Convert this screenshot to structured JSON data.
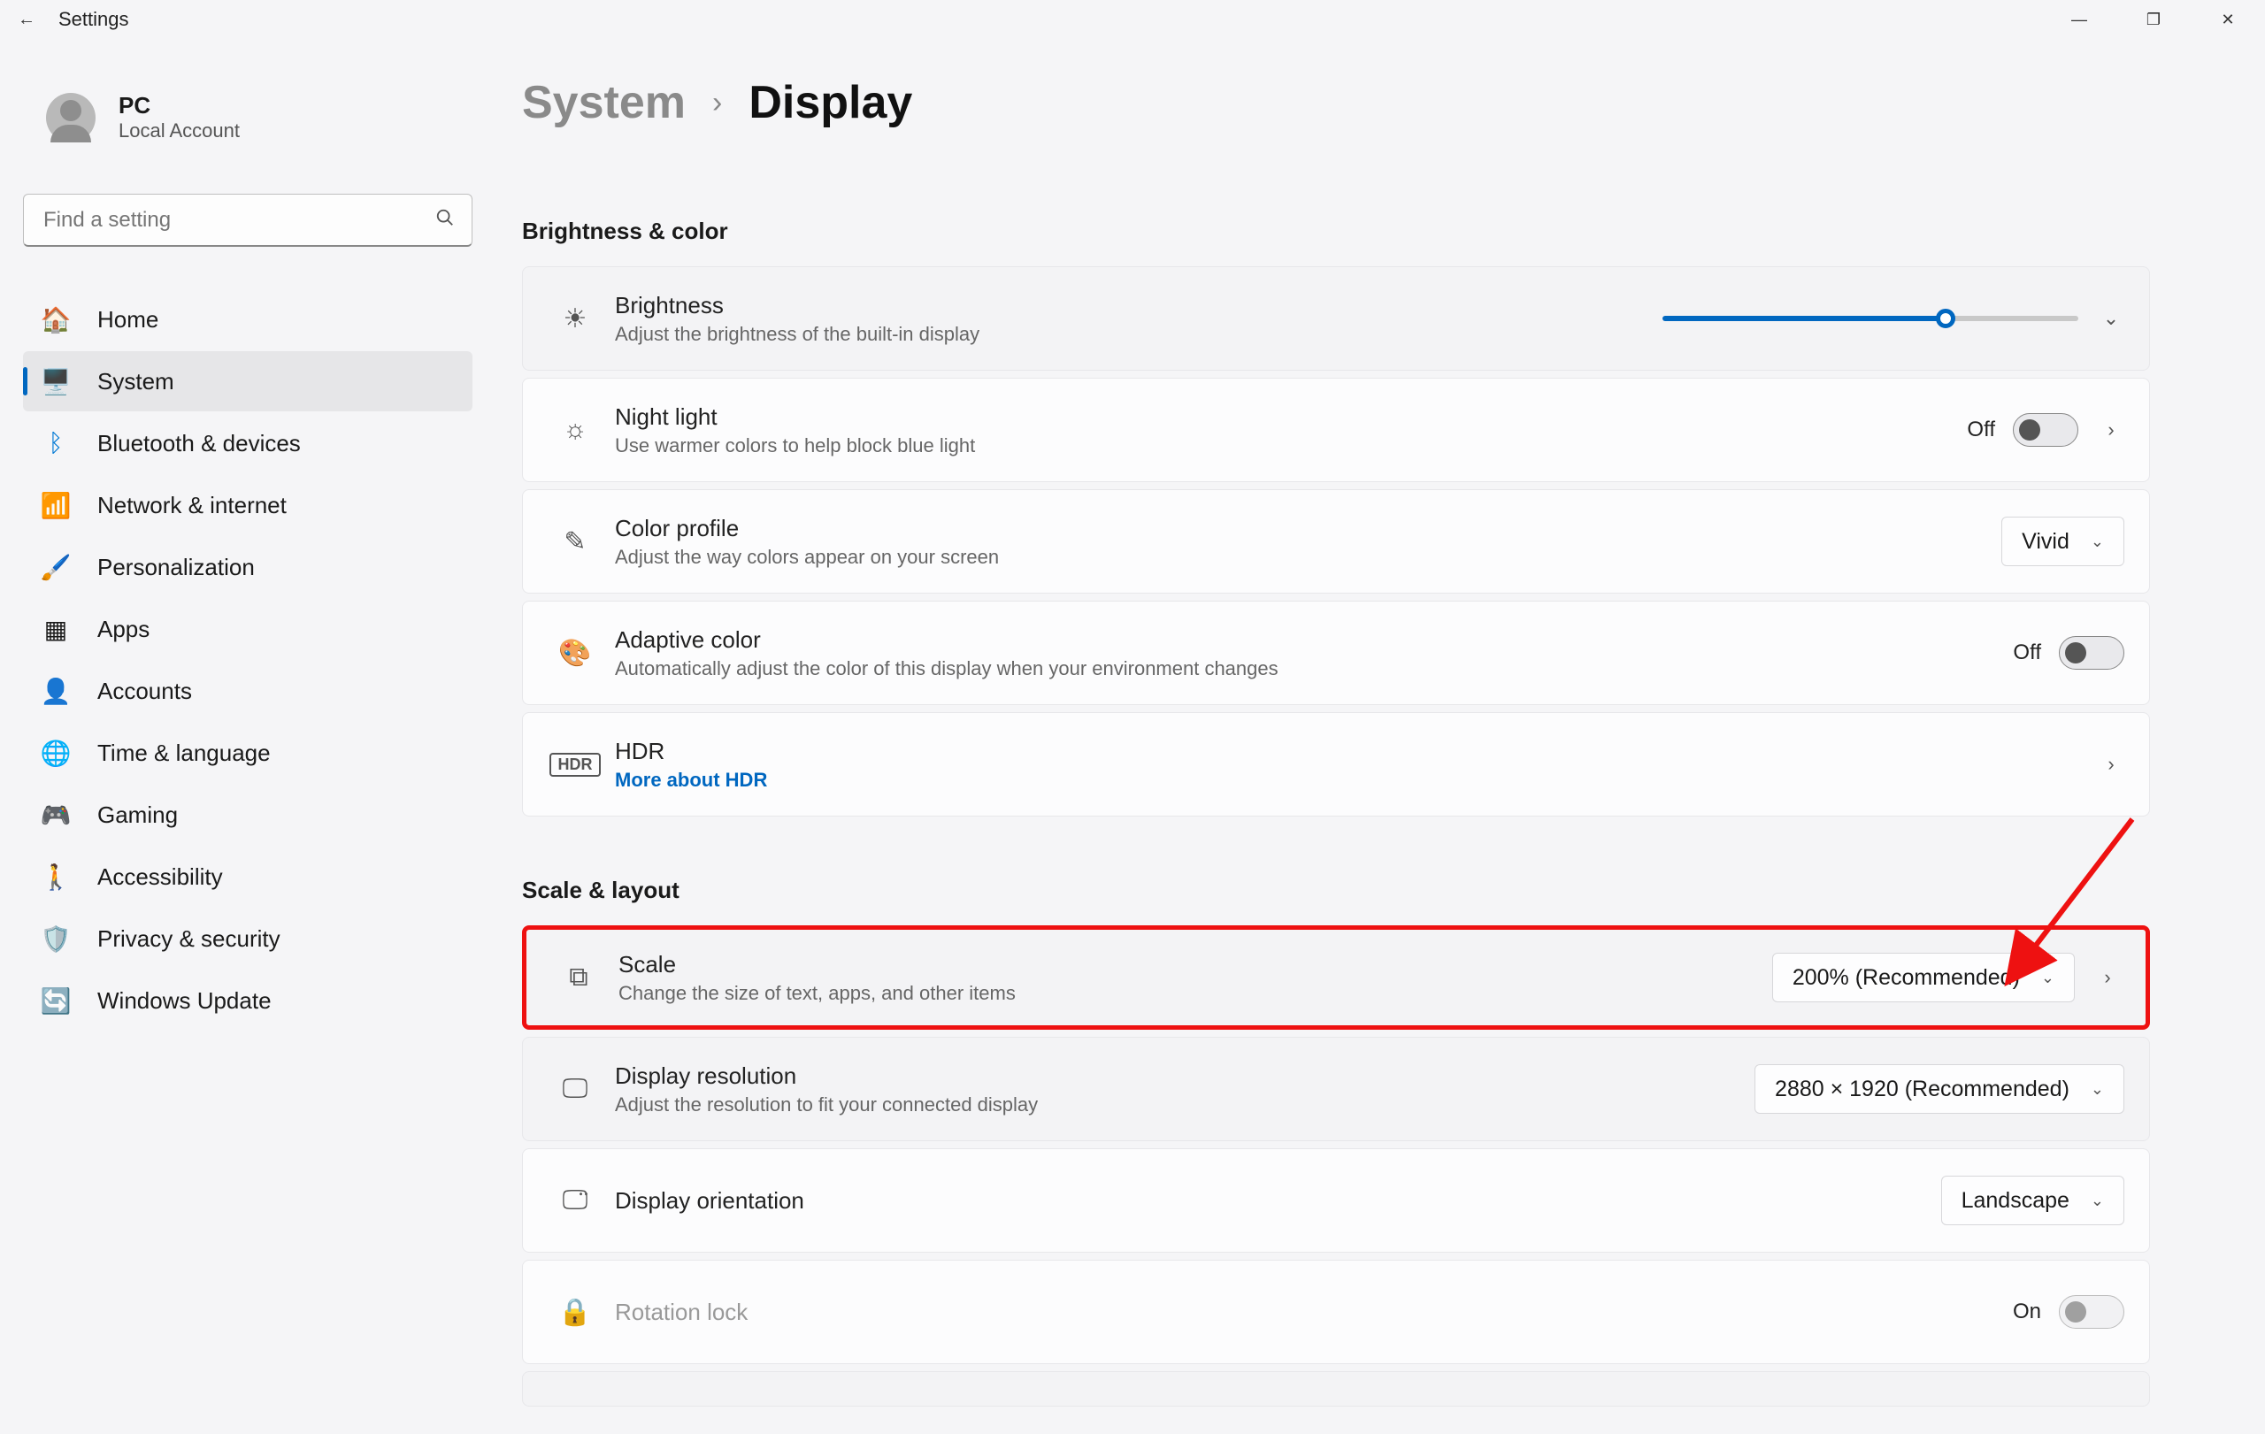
{
  "app": {
    "title": "Settings"
  },
  "account": {
    "name": "PC",
    "type": "Local Account"
  },
  "search": {
    "placeholder": "Find a setting"
  },
  "nav": {
    "items": [
      {
        "label": "Home"
      },
      {
        "label": "System"
      },
      {
        "label": "Bluetooth & devices"
      },
      {
        "label": "Network & internet"
      },
      {
        "label": "Personalization"
      },
      {
        "label": "Apps"
      },
      {
        "label": "Accounts"
      },
      {
        "label": "Time & language"
      },
      {
        "label": "Gaming"
      },
      {
        "label": "Accessibility"
      },
      {
        "label": "Privacy & security"
      },
      {
        "label": "Windows Update"
      }
    ],
    "active_index": 1
  },
  "breadcrumb": {
    "parent": "System",
    "current": "Display"
  },
  "sections": {
    "brightness_color": {
      "heading": "Brightness & color",
      "brightness": {
        "title": "Brightness",
        "sub": "Adjust the brightness of the built-in display",
        "value_pct": 68
      },
      "night_light": {
        "title": "Night light",
        "sub": "Use warmer colors to help block blue light",
        "state_label": "Off",
        "on": false
      },
      "color_profile": {
        "title": "Color profile",
        "sub": "Adjust the way colors appear on your screen",
        "value": "Vivid"
      },
      "adaptive_color": {
        "title": "Adaptive color",
        "sub": "Automatically adjust the color of this display when your environment changes",
        "state_label": "Off",
        "on": false
      },
      "hdr": {
        "title": "HDR",
        "link": "More about HDR"
      }
    },
    "scale_layout": {
      "heading": "Scale & layout",
      "scale": {
        "title": "Scale",
        "sub": "Change the size of text, apps, and other items",
        "value": "200% (Recommended)"
      },
      "resolution": {
        "title": "Display resolution",
        "sub": "Adjust the resolution to fit your connected display",
        "value": "2880 × 1920 (Recommended)"
      },
      "orientation": {
        "title": "Display orientation",
        "value": "Landscape"
      },
      "rotation_lock": {
        "title": "Rotation lock",
        "state_label": "On",
        "on": true,
        "disabled": true
      }
    }
  }
}
